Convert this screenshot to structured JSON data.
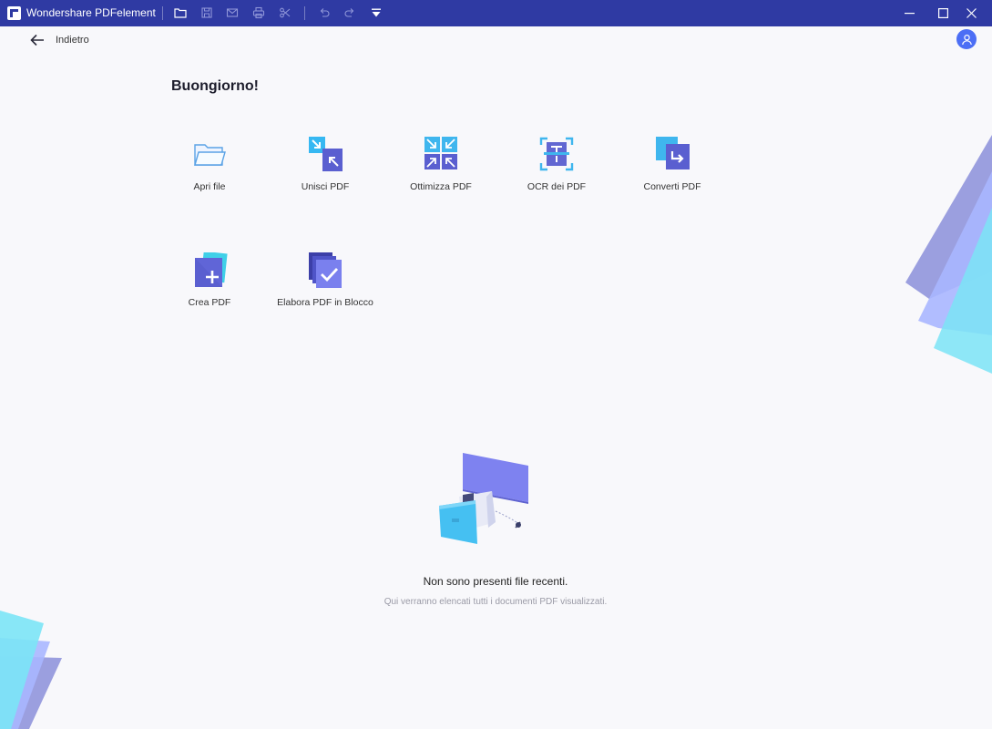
{
  "window": {
    "title": "Wondershare PDFelement"
  },
  "header": {
    "back_label": "Indietro"
  },
  "greeting": "Buongiorno!",
  "tools": [
    {
      "label": "Apri file",
      "icon": "folder-icon"
    },
    {
      "label": "Unisci PDF",
      "icon": "merge-icon"
    },
    {
      "label": "Ottimizza PDF",
      "icon": "optimize-icon"
    },
    {
      "label": "OCR dei PDF",
      "icon": "ocr-icon"
    },
    {
      "label": "Converti PDF",
      "icon": "convert-icon"
    },
    {
      "label": "Crea PDF",
      "icon": "create-icon"
    },
    {
      "label": "Elabora PDF in Blocco",
      "icon": "batch-icon"
    }
  ],
  "empty_state": {
    "title": "Non sono presenti file recenti.",
    "subtitle": "Qui verranno elencati tutti i documenti PDF visualizzati."
  },
  "colors": {
    "titlebar": "#2f3aa3",
    "accent": "#4c6ef5",
    "background": "#f8f8fb"
  }
}
